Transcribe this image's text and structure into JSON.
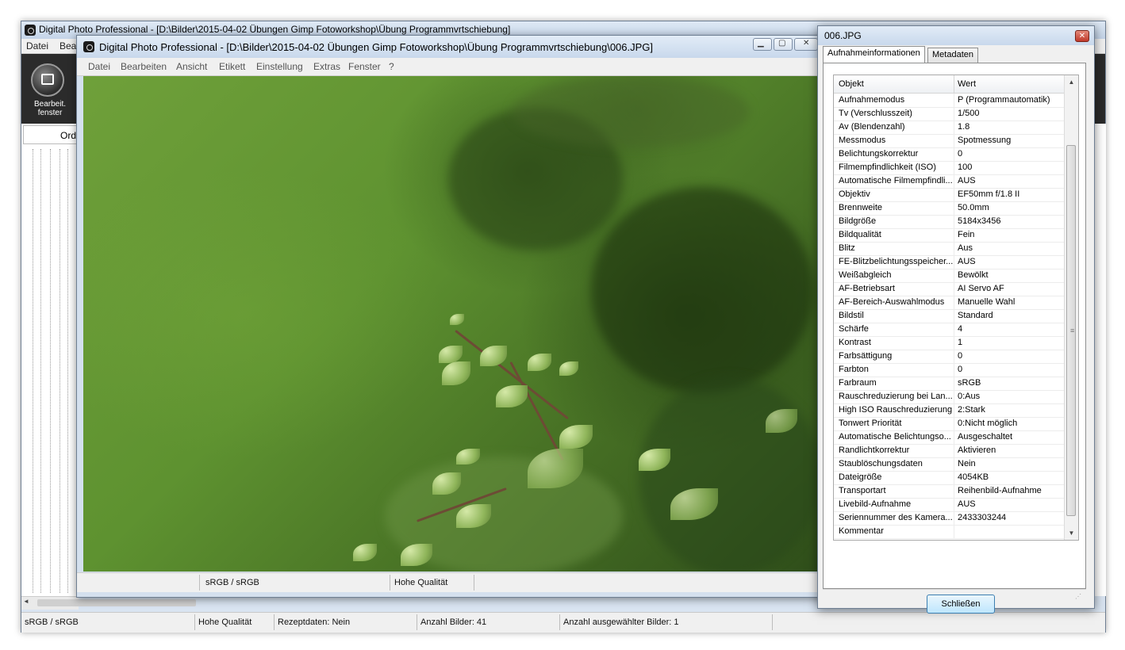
{
  "bg_window": {
    "title": "Digital Photo Professional - [D:\\Bilder\\2015-04-02 Übungen  Gimp Fotoworkshop\\Übung Programmvrtschiebung]",
    "menu": [
      "Datei",
      "Bea"
    ],
    "edit_button_label": "Bearbeit. fenster",
    "folder_header": "Ordn",
    "status": {
      "color_space": "sRGB / sRGB",
      "quality": "Hohe Qualität",
      "recipe": "Rezeptdaten: Nein",
      "count": "Anzahl Bilder: 41",
      "selected": "Anzahl ausgewählter Bilder: 1"
    }
  },
  "image_window": {
    "title": "Digital Photo Professional - [D:\\Bilder\\2015-04-02 Übungen  Gimp Fotoworkshop\\Übung Programmvrtschiebung\\006.JPG]",
    "menu": [
      "Datei",
      "Bearbeiten",
      "Ansicht",
      "Etikett",
      "Einstellung",
      "Extras",
      "Fenster",
      "?"
    ],
    "status": {
      "color_space": "sRGB / sRGB",
      "quality": "Hohe Qualität"
    }
  },
  "dialog": {
    "title": "006.JPG",
    "tabs": [
      "Aufnahmeinformationen",
      "Metadaten"
    ],
    "columns": [
      "Objekt",
      "Wert"
    ],
    "rows": [
      [
        "Aufnahmemodus",
        "P (Programmautomatik)"
      ],
      [
        "Tv (Verschlusszeit)",
        "1/500"
      ],
      [
        "Av (Blendenzahl)",
        "1.8"
      ],
      [
        "Messmodus",
        "Spotmessung"
      ],
      [
        "Belichtungskorrektur",
        "0"
      ],
      [
        "Filmempfindlichkeit (ISO)",
        "100"
      ],
      [
        "Automatische Filmempfindli...",
        "AUS"
      ],
      [
        "Objektiv",
        "EF50mm f/1.8 II"
      ],
      [
        "Brennweite",
        "50.0mm"
      ],
      [
        "Bildgröße",
        "5184x3456"
      ],
      [
        "Bildqualität",
        "Fein"
      ],
      [
        "Blitz",
        "Aus"
      ],
      [
        "FE-Blitzbelichtungsspeicher...",
        "AUS"
      ],
      [
        "Weißabgleich",
        "Bewölkt"
      ],
      [
        "AF-Betriebsart",
        "AI Servo AF"
      ],
      [
        "AF-Bereich-Auswahlmodus",
        "Manuelle  Wahl"
      ],
      [
        "Bildstil",
        "Standard"
      ],
      [
        "Schärfe",
        "4"
      ],
      [
        "Kontrast",
        "1"
      ],
      [
        "Farbsättigung",
        "0"
      ],
      [
        "Farbton",
        "0"
      ],
      [
        "Farbraum",
        "sRGB"
      ],
      [
        "Rauschreduzierung bei Lan...",
        "0:Aus"
      ],
      [
        "High ISO Rauschreduzierung",
        "2:Stark"
      ],
      [
        "Tonwert Priorität",
        "0:Nicht möglich"
      ],
      [
        "Automatische Belichtungso...",
        "Ausgeschaltet"
      ],
      [
        "Randlichtkorrektur",
        "Aktivieren"
      ],
      [
        "Staublöschungsdaten",
        "Nein"
      ],
      [
        "Dateigröße",
        "4054KB"
      ],
      [
        "Transportart",
        "Reihenbild-Aufnahme"
      ],
      [
        "Livebild-Aufnahme",
        "AUS"
      ],
      [
        "Seriennummer des Kamera...",
        "2433303244"
      ],
      [
        "Kommentar",
        ""
      ]
    ],
    "close_button": "Schließen"
  }
}
